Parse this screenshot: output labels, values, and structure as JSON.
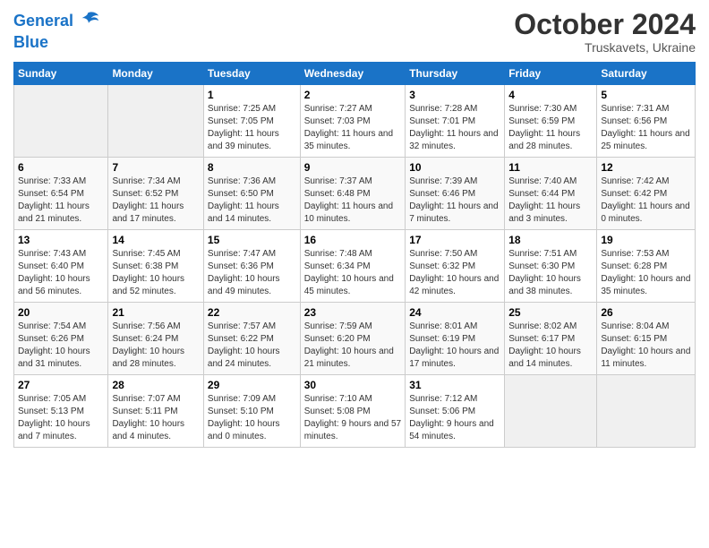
{
  "header": {
    "logo_line1": "General",
    "logo_line2": "Blue",
    "main_title": "October 2024",
    "subtitle": "Truskavets, Ukraine"
  },
  "columns": [
    "Sunday",
    "Monday",
    "Tuesday",
    "Wednesday",
    "Thursday",
    "Friday",
    "Saturday"
  ],
  "weeks": [
    [
      {
        "num": "",
        "sunrise": "",
        "sunset": "",
        "daylight": "",
        "empty": true
      },
      {
        "num": "",
        "sunrise": "",
        "sunset": "",
        "daylight": "",
        "empty": true
      },
      {
        "num": "1",
        "sunrise": "Sunrise: 7:25 AM",
        "sunset": "Sunset: 7:05 PM",
        "daylight": "Daylight: 11 hours and 39 minutes.",
        "empty": false
      },
      {
        "num": "2",
        "sunrise": "Sunrise: 7:27 AM",
        "sunset": "Sunset: 7:03 PM",
        "daylight": "Daylight: 11 hours and 35 minutes.",
        "empty": false
      },
      {
        "num": "3",
        "sunrise": "Sunrise: 7:28 AM",
        "sunset": "Sunset: 7:01 PM",
        "daylight": "Daylight: 11 hours and 32 minutes.",
        "empty": false
      },
      {
        "num": "4",
        "sunrise": "Sunrise: 7:30 AM",
        "sunset": "Sunset: 6:59 PM",
        "daylight": "Daylight: 11 hours and 28 minutes.",
        "empty": false
      },
      {
        "num": "5",
        "sunrise": "Sunrise: 7:31 AM",
        "sunset": "Sunset: 6:56 PM",
        "daylight": "Daylight: 11 hours and 25 minutes.",
        "empty": false
      }
    ],
    [
      {
        "num": "6",
        "sunrise": "Sunrise: 7:33 AM",
        "sunset": "Sunset: 6:54 PM",
        "daylight": "Daylight: 11 hours and 21 minutes.",
        "empty": false
      },
      {
        "num": "7",
        "sunrise": "Sunrise: 7:34 AM",
        "sunset": "Sunset: 6:52 PM",
        "daylight": "Daylight: 11 hours and 17 minutes.",
        "empty": false
      },
      {
        "num": "8",
        "sunrise": "Sunrise: 7:36 AM",
        "sunset": "Sunset: 6:50 PM",
        "daylight": "Daylight: 11 hours and 14 minutes.",
        "empty": false
      },
      {
        "num": "9",
        "sunrise": "Sunrise: 7:37 AM",
        "sunset": "Sunset: 6:48 PM",
        "daylight": "Daylight: 11 hours and 10 minutes.",
        "empty": false
      },
      {
        "num": "10",
        "sunrise": "Sunrise: 7:39 AM",
        "sunset": "Sunset: 6:46 PM",
        "daylight": "Daylight: 11 hours and 7 minutes.",
        "empty": false
      },
      {
        "num": "11",
        "sunrise": "Sunrise: 7:40 AM",
        "sunset": "Sunset: 6:44 PM",
        "daylight": "Daylight: 11 hours and 3 minutes.",
        "empty": false
      },
      {
        "num": "12",
        "sunrise": "Sunrise: 7:42 AM",
        "sunset": "Sunset: 6:42 PM",
        "daylight": "Daylight: 11 hours and 0 minutes.",
        "empty": false
      }
    ],
    [
      {
        "num": "13",
        "sunrise": "Sunrise: 7:43 AM",
        "sunset": "Sunset: 6:40 PM",
        "daylight": "Daylight: 10 hours and 56 minutes.",
        "empty": false
      },
      {
        "num": "14",
        "sunrise": "Sunrise: 7:45 AM",
        "sunset": "Sunset: 6:38 PM",
        "daylight": "Daylight: 10 hours and 52 minutes.",
        "empty": false
      },
      {
        "num": "15",
        "sunrise": "Sunrise: 7:47 AM",
        "sunset": "Sunset: 6:36 PM",
        "daylight": "Daylight: 10 hours and 49 minutes.",
        "empty": false
      },
      {
        "num": "16",
        "sunrise": "Sunrise: 7:48 AM",
        "sunset": "Sunset: 6:34 PM",
        "daylight": "Daylight: 10 hours and 45 minutes.",
        "empty": false
      },
      {
        "num": "17",
        "sunrise": "Sunrise: 7:50 AM",
        "sunset": "Sunset: 6:32 PM",
        "daylight": "Daylight: 10 hours and 42 minutes.",
        "empty": false
      },
      {
        "num": "18",
        "sunrise": "Sunrise: 7:51 AM",
        "sunset": "Sunset: 6:30 PM",
        "daylight": "Daylight: 10 hours and 38 minutes.",
        "empty": false
      },
      {
        "num": "19",
        "sunrise": "Sunrise: 7:53 AM",
        "sunset": "Sunset: 6:28 PM",
        "daylight": "Daylight: 10 hours and 35 minutes.",
        "empty": false
      }
    ],
    [
      {
        "num": "20",
        "sunrise": "Sunrise: 7:54 AM",
        "sunset": "Sunset: 6:26 PM",
        "daylight": "Daylight: 10 hours and 31 minutes.",
        "empty": false
      },
      {
        "num": "21",
        "sunrise": "Sunrise: 7:56 AM",
        "sunset": "Sunset: 6:24 PM",
        "daylight": "Daylight: 10 hours and 28 minutes.",
        "empty": false
      },
      {
        "num": "22",
        "sunrise": "Sunrise: 7:57 AM",
        "sunset": "Sunset: 6:22 PM",
        "daylight": "Daylight: 10 hours and 24 minutes.",
        "empty": false
      },
      {
        "num": "23",
        "sunrise": "Sunrise: 7:59 AM",
        "sunset": "Sunset: 6:20 PM",
        "daylight": "Daylight: 10 hours and 21 minutes.",
        "empty": false
      },
      {
        "num": "24",
        "sunrise": "Sunrise: 8:01 AM",
        "sunset": "Sunset: 6:19 PM",
        "daylight": "Daylight: 10 hours and 17 minutes.",
        "empty": false
      },
      {
        "num": "25",
        "sunrise": "Sunrise: 8:02 AM",
        "sunset": "Sunset: 6:17 PM",
        "daylight": "Daylight: 10 hours and 14 minutes.",
        "empty": false
      },
      {
        "num": "26",
        "sunrise": "Sunrise: 8:04 AM",
        "sunset": "Sunset: 6:15 PM",
        "daylight": "Daylight: 10 hours and 11 minutes.",
        "empty": false
      }
    ],
    [
      {
        "num": "27",
        "sunrise": "Sunrise: 7:05 AM",
        "sunset": "Sunset: 5:13 PM",
        "daylight": "Daylight: 10 hours and 7 minutes.",
        "empty": false
      },
      {
        "num": "28",
        "sunrise": "Sunrise: 7:07 AM",
        "sunset": "Sunset: 5:11 PM",
        "daylight": "Daylight: 10 hours and 4 minutes.",
        "empty": false
      },
      {
        "num": "29",
        "sunrise": "Sunrise: 7:09 AM",
        "sunset": "Sunset: 5:10 PM",
        "daylight": "Daylight: 10 hours and 0 minutes.",
        "empty": false
      },
      {
        "num": "30",
        "sunrise": "Sunrise: 7:10 AM",
        "sunset": "Sunset: 5:08 PM",
        "daylight": "Daylight: 9 hours and 57 minutes.",
        "empty": false
      },
      {
        "num": "31",
        "sunrise": "Sunrise: 7:12 AM",
        "sunset": "Sunset: 5:06 PM",
        "daylight": "Daylight: 9 hours and 54 minutes.",
        "empty": false
      },
      {
        "num": "",
        "sunrise": "",
        "sunset": "",
        "daylight": "",
        "empty": true
      },
      {
        "num": "",
        "sunrise": "",
        "sunset": "",
        "daylight": "",
        "empty": true
      }
    ]
  ]
}
